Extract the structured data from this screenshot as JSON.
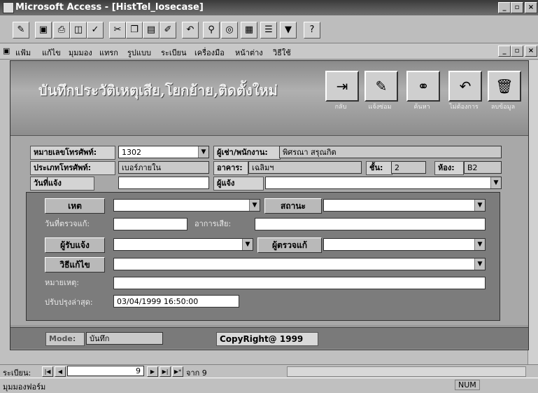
{
  "window": {
    "title": "Microsoft Access - [HistTel_losecase]"
  },
  "menu": {
    "items": [
      "แฟ้ม",
      "แก้ไข",
      "มุมมอง",
      "แทรก",
      "รูปแบบ",
      "ระเบียน",
      "เครื่องมือ",
      "หน้าต่าง",
      "วิธีใช้"
    ]
  },
  "form": {
    "title": "บันทึกประวัติเหตุเสีย,โยกย้าย,ติดตั้งใหม่",
    "header_buttons": [
      {
        "icon": "exit-icon",
        "caption": "กลับ"
      },
      {
        "icon": "tools-icon",
        "caption": "แจ้งซ่อม"
      },
      {
        "icon": "binoculars-icon",
        "caption": "ค้นหา"
      },
      {
        "icon": "undo-icon",
        "caption": "ไม่ต้องการ"
      },
      {
        "icon": "trash-icon",
        "caption": "ลบข้อมูล"
      }
    ],
    "fields": {
      "phone_number_label": "หมายเลขโทรศัพท์:",
      "phone_number_value": "1302",
      "user_label": "ผู้เช่า/พนักงาน:",
      "user_value": "พิศรณา สรุณกิต",
      "phone_type_label": "ประเภทโทรศัพท์:",
      "phone_type_value": "เบอร์ภายใน",
      "building_label": "อาคาร:",
      "building_value": "เฉลิมฯ",
      "floor_label": "ชั้น:",
      "floor_value": "2",
      "room_label": "ห้อง:",
      "room_value": "B2",
      "date_reported_label": "วันที่แจ้ง",
      "date_reported_value": "",
      "reporter_label": "ผู้แจ้ง",
      "reporter_value": ""
    },
    "inner": {
      "cause_button": "เหต",
      "cause_value": "",
      "status_button": "สถานะ",
      "status_value": "",
      "check_date_label": "วันที่ตรวจแก้:",
      "check_date_value": "",
      "symptom_label": "อาการเสีย:",
      "symptom_value": "",
      "receiver_button": "ผู้รับแจ้ง",
      "receiver_value": "",
      "inspector_button": "ผู้ตรวจแก้",
      "inspector_value": "",
      "method_button": "วิธีแก้ไข",
      "method_value": "",
      "note_label": "หมายเหตุ:",
      "note_value": "",
      "updated_label": "ปรับปรุงล่าสุด:",
      "updated_value": "03/04/1999 16:50:00"
    },
    "footer": {
      "mode_label": "Mode:",
      "mode_value": "บันทึก",
      "copyright": "CopyRight@ 1999"
    }
  },
  "record_nav": {
    "label": "ระเบียน:",
    "current": "9",
    "of_label": "จาก 9"
  },
  "status": {
    "left": "มุมมองฟอร์ม",
    "num": "NUM"
  }
}
